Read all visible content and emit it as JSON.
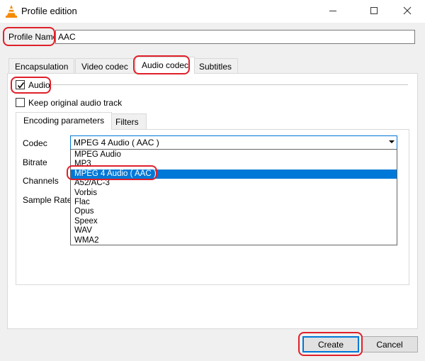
{
  "window": {
    "title": "Profile edition",
    "icon": "vlc-cone-icon",
    "controls": [
      "minimize-icon",
      "maximize-icon",
      "close-icon"
    ]
  },
  "profile": {
    "label": "Profile Name",
    "value": "AAC"
  },
  "tabs": [
    {
      "label": "Encapsulation",
      "active": false
    },
    {
      "label": "Video codec",
      "active": false
    },
    {
      "label": "Audio codec",
      "active": true
    },
    {
      "label": "Subtitles",
      "active": false
    }
  ],
  "audio": {
    "checkbox_label": "Audio",
    "checked": true,
    "keep_original_label": "Keep original audio track",
    "keep_original_checked": false
  },
  "subtabs": [
    {
      "label": "Encoding parameters",
      "active": true
    },
    {
      "label": "Filters",
      "active": false
    }
  ],
  "fields": {
    "codec_label": "Codec",
    "bitrate_label": "Bitrate",
    "channels_label": "Channels",
    "sample_rate_label": "Sample Rate"
  },
  "codec": {
    "selected": "MPEG 4 Audio ( AAC )",
    "options": [
      "MPEG Audio",
      "MP3",
      "MPEG 4 Audio ( AAC )",
      "A52/AC-3",
      "Vorbis",
      "Flac",
      "Opus",
      "Speex",
      "WAV",
      "WMA2"
    ],
    "highlighted_index": 2
  },
  "buttons": {
    "create": "Create",
    "cancel": "Cancel"
  },
  "colors": {
    "accent": "#0078d7",
    "highlight_ring": "#e0202a",
    "vlc_orange": "#f48b00"
  }
}
